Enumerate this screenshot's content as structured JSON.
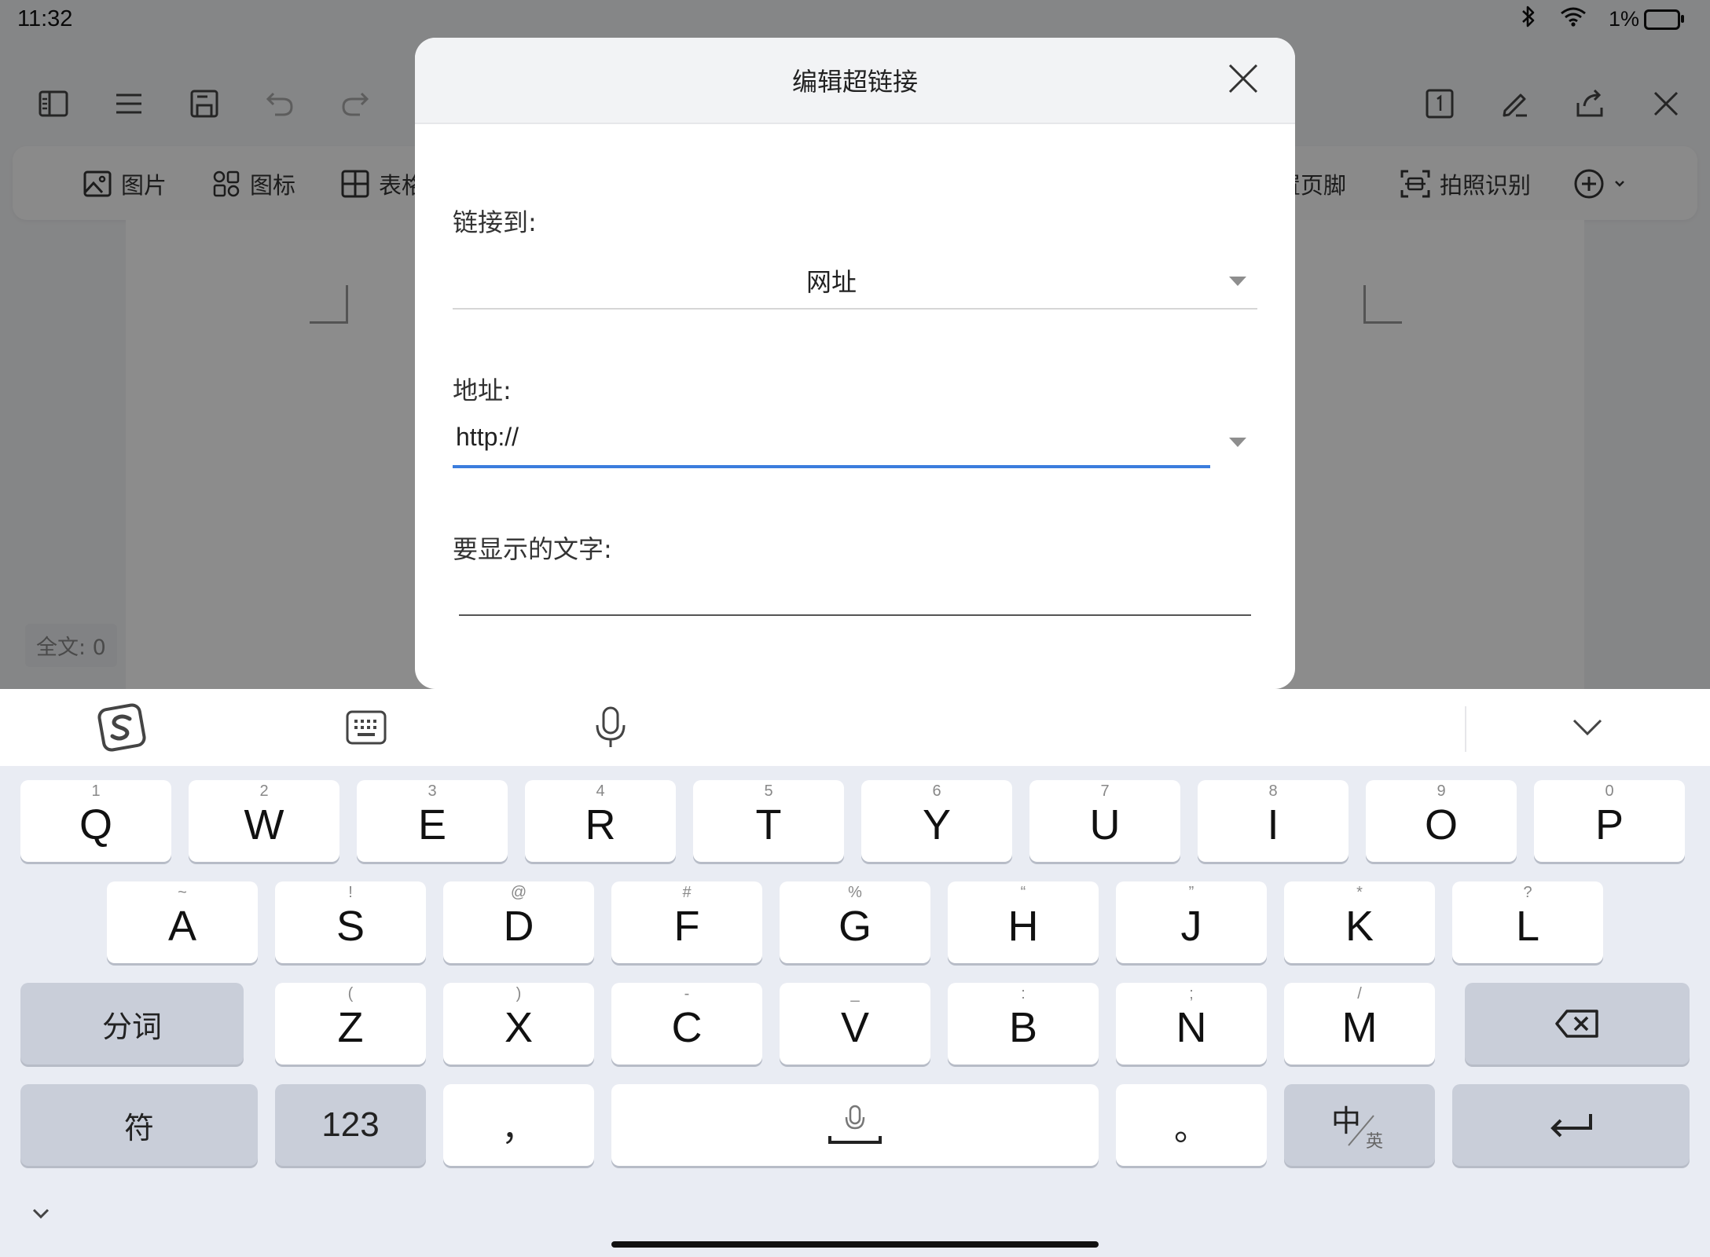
{
  "status_bar": {
    "time": "11:32",
    "battery": "1%"
  },
  "ribbon": {
    "items": [
      {
        "icon": "image-icon",
        "label": "图片"
      },
      {
        "icon": "shapes-icon",
        "label": "图标"
      },
      {
        "icon": "table-icon",
        "label": "表格"
      },
      {
        "icon": "",
        "label": "置页脚"
      },
      {
        "icon": "scan-icon",
        "label": "拍照识别"
      }
    ]
  },
  "document": {
    "word_count": "全文: 0"
  },
  "dialog": {
    "title": "编辑超链接",
    "link_to_label": "链接到:",
    "link_to_value": "网址",
    "address_label": "地址:",
    "address_value": "http://",
    "display_text_label": "要显示的文字:",
    "display_text_value": ""
  },
  "keyboard": {
    "row1": [
      {
        "key": "Q",
        "sub": "1"
      },
      {
        "key": "W",
        "sub": "2"
      },
      {
        "key": "E",
        "sub": "3"
      },
      {
        "key": "R",
        "sub": "4"
      },
      {
        "key": "T",
        "sub": "5"
      },
      {
        "key": "Y",
        "sub": "6"
      },
      {
        "key": "U",
        "sub": "7"
      },
      {
        "key": "I",
        "sub": "8"
      },
      {
        "key": "O",
        "sub": "9"
      },
      {
        "key": "P",
        "sub": "0"
      }
    ],
    "row2": [
      {
        "key": "A",
        "sub": "~"
      },
      {
        "key": "S",
        "sub": "!"
      },
      {
        "key": "D",
        "sub": "@"
      },
      {
        "key": "F",
        "sub": "#"
      },
      {
        "key": "G",
        "sub": "%"
      },
      {
        "key": "H",
        "sub": "“"
      },
      {
        "key": "J",
        "sub": "”"
      },
      {
        "key": "K",
        "sub": "*"
      },
      {
        "key": "L",
        "sub": "?"
      }
    ],
    "row3": [
      {
        "key": "Z",
        "sub": "("
      },
      {
        "key": "X",
        "sub": ")"
      },
      {
        "key": "C",
        "sub": "-"
      },
      {
        "key": "V",
        "sub": "_"
      },
      {
        "key": "B",
        "sub": ":"
      },
      {
        "key": "N",
        "sub": ";"
      },
      {
        "key": "M",
        "sub": "/"
      }
    ],
    "segment_label": "分词",
    "symbols_label": "符",
    "numbers_label": "123",
    "comma": "，",
    "period": "。",
    "lang_main": "中",
    "lang_sub": "英"
  }
}
